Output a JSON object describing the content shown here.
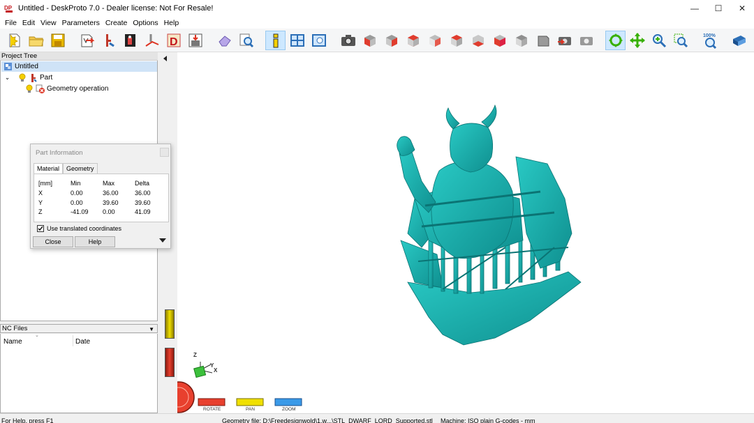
{
  "window": {
    "title": "Untitled - DeskProto 7.0 - Dealer license: Not For Resale!",
    "controls": {
      "minimize": "—",
      "maximize": "☐",
      "close": "✕"
    }
  },
  "menu": [
    "File",
    "Edit",
    "View",
    "Parameters",
    "Create",
    "Options",
    "Help"
  ],
  "toolbar": {
    "zoom_label": "100%"
  },
  "project_tree": {
    "header": "Project Tree",
    "items": [
      {
        "label": "Untitled",
        "selected": true
      },
      {
        "label": "Part",
        "selected": false
      },
      {
        "label": "Geometry operation",
        "selected": false
      }
    ]
  },
  "nc_files": {
    "header": "NC Files",
    "columns": [
      "Name",
      "Date"
    ]
  },
  "part_information": {
    "title": "Part Information",
    "tabs": [
      "Material",
      "Geometry"
    ],
    "active_tab": "Material",
    "headers": [
      "[mm]",
      "Min",
      "Max",
      "Delta"
    ],
    "rows": [
      {
        "axis": "X",
        "min": "0.00",
        "max": "36.00",
        "delta": "36.00"
      },
      {
        "axis": "Y",
        "min": "0.00",
        "max": "39.60",
        "delta": "39.60"
      },
      {
        "axis": "Z",
        "min": "-41.09",
        "max": "0.00",
        "delta": "41.09"
      }
    ],
    "checkbox_label": "Use translated coordinates",
    "checkbox_checked": true,
    "close_label": "Close",
    "help_label": "Help"
  },
  "viewport": {
    "axes": {
      "z": "Z",
      "y": "Y",
      "x": "X"
    },
    "controls": [
      "ROTATE",
      "PAN",
      "ZOOM"
    ],
    "model_color": "#1ab0b0"
  },
  "statusbar": {
    "help": "For Help, press F1",
    "geometry": "Geometry file: D:\\Freedesignwold\\1.w...\\STL_DWARF_LORD_Supported.stl",
    "machine": "Machine: ISO plain G-codes - mm"
  }
}
